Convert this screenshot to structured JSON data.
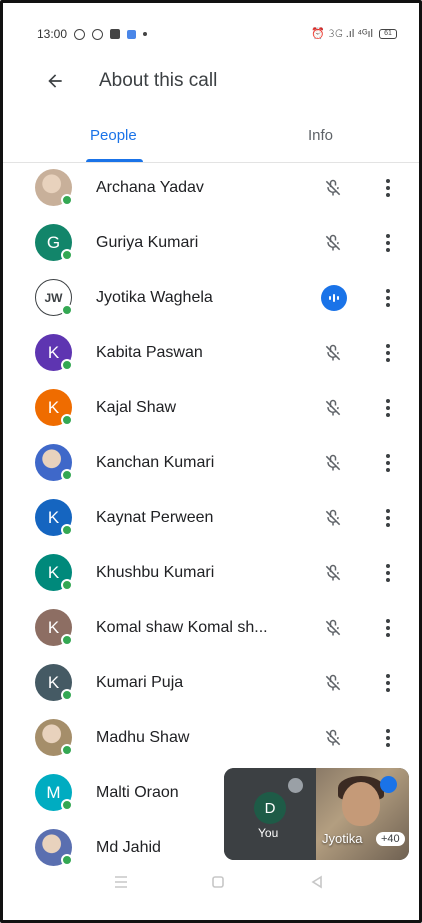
{
  "status_bar": {
    "time": "13:00",
    "right_text": "⏰ 𝟹𝙶 .ıl ⁴ᴳıl",
    "battery": "61"
  },
  "header": {
    "title": "About this call",
    "back_icon": "arrow-back-icon"
  },
  "tabs": [
    {
      "label": "People",
      "active": true
    },
    {
      "label": "Info",
      "active": false
    }
  ],
  "participants": [
    {
      "name": "Archana Yadav",
      "avatar": "photo",
      "avatar_color": "#c8b09a",
      "status": "muted"
    },
    {
      "name": "Guriya Kumari",
      "avatar": "G",
      "avatar_color": "#12856a",
      "status": "muted"
    },
    {
      "name": "Jyotika Waghela",
      "avatar": "JW",
      "avatar_color": "#ffffff",
      "status": "speaking"
    },
    {
      "name": "Kabita Paswan",
      "avatar": "K",
      "avatar_color": "#5e35b1",
      "status": "muted"
    },
    {
      "name": "Kajal Shaw",
      "avatar": "K",
      "avatar_color": "#ef6c00",
      "status": "muted"
    },
    {
      "name": "Kanchan Kumari",
      "avatar": "photo",
      "avatar_color": "#3f68c9",
      "status": "muted"
    },
    {
      "name": "Kaynat Perween",
      "avatar": "K",
      "avatar_color": "#1565c0",
      "status": "muted"
    },
    {
      "name": "Khushbu Kumari",
      "avatar": "K",
      "avatar_color": "#00897b",
      "status": "muted"
    },
    {
      "name": "Komal shaw Komal sh...",
      "avatar": "K",
      "avatar_color": "#8d6e63",
      "status": "muted"
    },
    {
      "name": "Kumari Puja",
      "avatar": "K",
      "avatar_color": "#455a64",
      "status": "muted"
    },
    {
      "name": "Madhu Shaw",
      "avatar": "photo",
      "avatar_color": "#a58e6a",
      "status": "muted"
    },
    {
      "name": "Malti Oraon",
      "avatar": "M",
      "avatar_color": "#00acc1",
      "status": "hidden"
    },
    {
      "name": "Md Jahid",
      "avatar": "photo",
      "avatar_color": "#5a6fb0",
      "status": "hidden"
    }
  ],
  "pip": {
    "self_initial": "D",
    "self_label": "You",
    "self_avatar_color": "#1e5b47",
    "other_name": "Jyotika",
    "overflow_count": "+40"
  },
  "colors": {
    "accent": "#1a73e8",
    "presence": "#34a853"
  }
}
